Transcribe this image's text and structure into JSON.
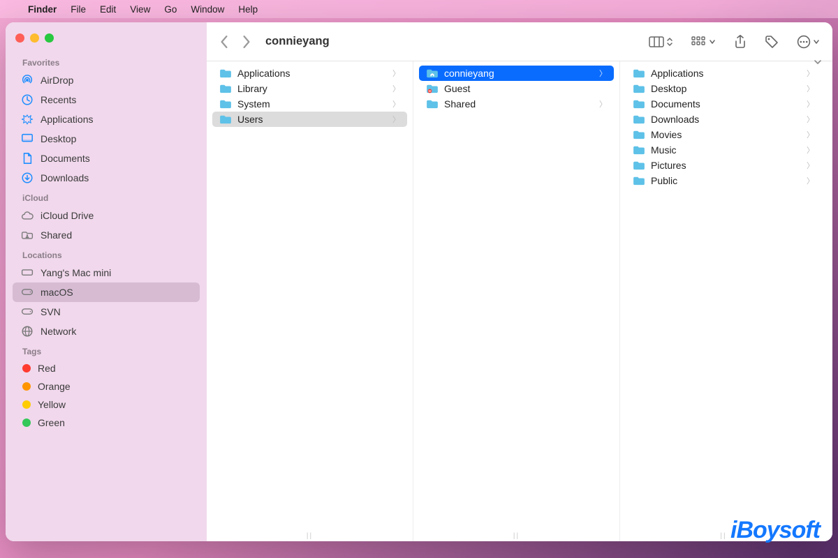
{
  "menubar": {
    "app": "Finder",
    "items": [
      "File",
      "Edit",
      "View",
      "Go",
      "Window",
      "Help"
    ]
  },
  "window": {
    "title": "connieyang"
  },
  "sidebar": {
    "sections": [
      {
        "title": "Favorites",
        "items": [
          {
            "icon": "airdrop",
            "label": "AirDrop"
          },
          {
            "icon": "recents",
            "label": "Recents"
          },
          {
            "icon": "applications",
            "label": "Applications"
          },
          {
            "icon": "desktop",
            "label": "Desktop"
          },
          {
            "icon": "documents",
            "label": "Documents"
          },
          {
            "icon": "downloads",
            "label": "Downloads"
          }
        ]
      },
      {
        "title": "iCloud",
        "items": [
          {
            "icon": "icloud",
            "label": "iCloud Drive"
          },
          {
            "icon": "shared",
            "label": "Shared"
          }
        ]
      },
      {
        "title": "Locations",
        "items": [
          {
            "icon": "mac",
            "label": "Yang's Mac mini"
          },
          {
            "icon": "disk",
            "label": "macOS",
            "selected": true
          },
          {
            "icon": "disk",
            "label": "SVN"
          },
          {
            "icon": "network",
            "label": "Network"
          }
        ]
      },
      {
        "title": "Tags",
        "items": [
          {
            "tag": "#ff3b30",
            "label": "Red"
          },
          {
            "tag": "#ff9500",
            "label": "Orange"
          },
          {
            "tag": "#ffcc00",
            "label": "Yellow"
          },
          {
            "tag": "#34c759",
            "label": "Green"
          }
        ]
      }
    ]
  },
  "columns": [
    {
      "items": [
        {
          "label": "Applications",
          "hasChildren": true
        },
        {
          "label": "Library",
          "hasChildren": true
        },
        {
          "label": "System",
          "hasChildren": true
        },
        {
          "label": "Users",
          "hasChildren": true,
          "selected": "gray"
        }
      ]
    },
    {
      "items": [
        {
          "label": "connieyang",
          "hasChildren": true,
          "selected": "blue",
          "icon": "home"
        },
        {
          "label": "Guest",
          "icon": "guest"
        },
        {
          "label": "Shared",
          "hasChildren": true
        }
      ]
    },
    {
      "items": [
        {
          "label": "Applications",
          "hasChildren": true
        },
        {
          "label": "Desktop",
          "hasChildren": true
        },
        {
          "label": "Documents",
          "hasChildren": true
        },
        {
          "label": "Downloads",
          "hasChildren": true
        },
        {
          "label": "Movies",
          "hasChildren": true
        },
        {
          "label": "Music",
          "hasChildren": true
        },
        {
          "label": "Pictures",
          "hasChildren": true
        },
        {
          "label": "Public",
          "hasChildren": true
        }
      ]
    }
  ],
  "watermark": "iBoysoft"
}
